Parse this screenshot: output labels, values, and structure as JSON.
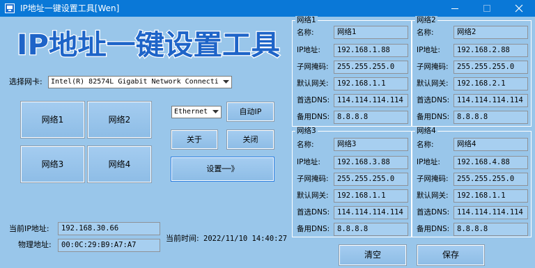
{
  "window": {
    "title": "IP地址一键设置工具[Wen]",
    "heading": "IP地址一键设置工具"
  },
  "adapter": {
    "label": "选择网卡:",
    "selected": "Intel(R) 82574L Gigabit Network Connecti"
  },
  "network_buttons": [
    "网络1",
    "网络2",
    "网络3",
    "网络4"
  ],
  "conn": {
    "selected": "Ethernet"
  },
  "buttons": {
    "auto_ip": "自动IP",
    "about": "关于",
    "close": "关闭",
    "set": "设置──》",
    "clear": "清空",
    "save": "保存"
  },
  "status": {
    "ip_label": "当前IP地址:",
    "ip_value": "192.168.30.66",
    "mac_label": "物理地址:",
    "mac_value": "00:0C:29:B9:A7:A7",
    "time_label": "当前时间:",
    "time_value": "2022/11/10 14:40:27"
  },
  "field_labels": {
    "name": "名称:",
    "ip": "IP地址:",
    "mask": "子网掩码:",
    "gateway": "默认网关:",
    "dns1": "首选DNS:",
    "dns2": "备用DNS:"
  },
  "groups": [
    {
      "title": "网络1",
      "name": "网络1",
      "ip": "192.168.1.88",
      "mask": "255.255.255.0",
      "gateway": "192.168.1.1",
      "dns1": "114.114.114.114",
      "dns2": "8.8.8.8"
    },
    {
      "title": "网络2",
      "name": "网络2",
      "ip": "192.168.2.88",
      "mask": "255.255.255.0",
      "gateway": "192.168.2.1",
      "dns1": "114.114.114.114",
      "dns2": "8.8.8.8"
    },
    {
      "title": "网络3",
      "name": "网络3",
      "ip": "192.168.3.88",
      "mask": "255.255.255.0",
      "gateway": "192.168.1.1",
      "dns1": "114.114.114.114",
      "dns2": "8.8.8.8"
    },
    {
      "title": "网络4",
      "name": "网络4",
      "ip": "192.168.4.88",
      "mask": "255.255.255.0",
      "gateway": "192.168.1.1",
      "dns1": "114.114.114.114",
      "dns2": "8.8.8.8"
    }
  ],
  "colors": {
    "titlebar": "#0a78d7",
    "background": "#99c6ea",
    "heading_fill": "#1e64c8",
    "heading_outline": "#ffffff"
  }
}
